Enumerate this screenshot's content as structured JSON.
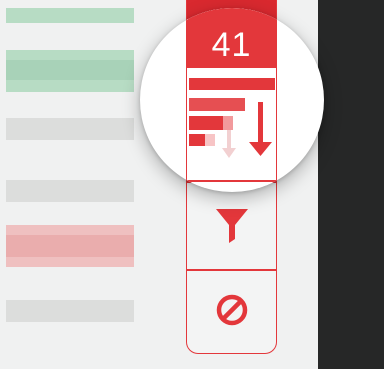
{
  "toolbar": {
    "record_count": "41",
    "sort_button_icon": "sort-descending-icon",
    "filter_button_icon": "filter-icon",
    "clear_button_icon": "clear-filter-icon"
  },
  "colors": {
    "accent": "#e3373b",
    "accent_dark": "#d9292f",
    "background": "#f0f1f1",
    "dark_panel": "#262727",
    "row_green": "#b7dcc4",
    "row_gray": "#dcdddc",
    "row_red": "#efc0c0"
  }
}
